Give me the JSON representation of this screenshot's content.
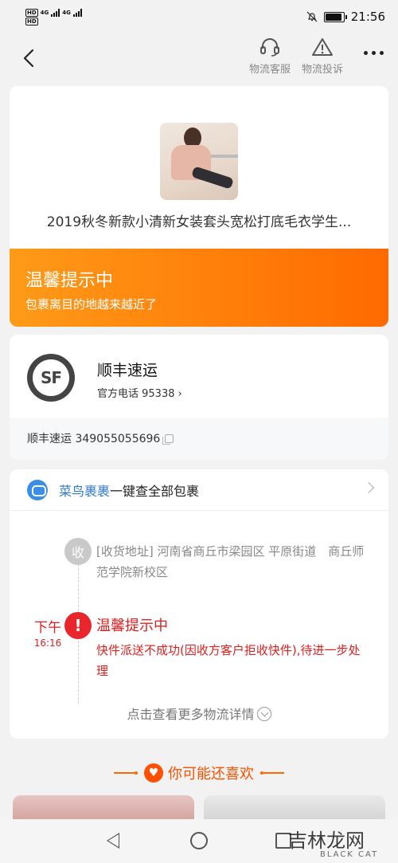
{
  "status_bar": {
    "hd1": "HD",
    "hd2": "HD",
    "net1": "4G",
    "net2": "4G",
    "time": "21:56"
  },
  "header": {
    "support_label": "物流客服",
    "complaint_label": "物流投诉"
  },
  "product": {
    "title": "2019秋冬新款小清新女装套头宽松打底毛衣学生..."
  },
  "banner": {
    "title": "温馨提示中",
    "subtitle": "包裹离目的地越来越近了"
  },
  "courier": {
    "logo_text": "SF",
    "name": "顺丰速运",
    "phone": "官方电话 95338",
    "phone_chevron": "›",
    "tracking": "顺丰速运 349055055696"
  },
  "cainiao": {
    "brand": "菜鸟裹裹",
    "text": "一键查全部包裹"
  },
  "timeline": {
    "receive_badge": "收",
    "receive_address": "[收货地址] 河南省商丘市梁园区 平原街道　商丘师范学院新校区",
    "alert_day": "下午",
    "alert_time": "16:16",
    "alert_icon": "!",
    "alert_title": "温馨提示中",
    "alert_desc": "快件派送不成功(因收方客户拒收快件),待进一步处理",
    "more_details": "点击查看更多物流详情"
  },
  "recommend": {
    "title": "你可能还喜欢"
  },
  "watermark": {
    "text": "吉林龙网",
    "sub": "BLACK CAT"
  },
  "colors": {
    "accent": "#ff6a00",
    "alert": "#e02020",
    "brand_blue": "#2f7ad1"
  },
  "icons": [
    "back-arrow-icon",
    "headset-icon",
    "warning-triangle-icon",
    "more-dots-icon",
    "copy-icon",
    "cainiao-icon",
    "chevron-right-icon",
    "heart-icon"
  ]
}
